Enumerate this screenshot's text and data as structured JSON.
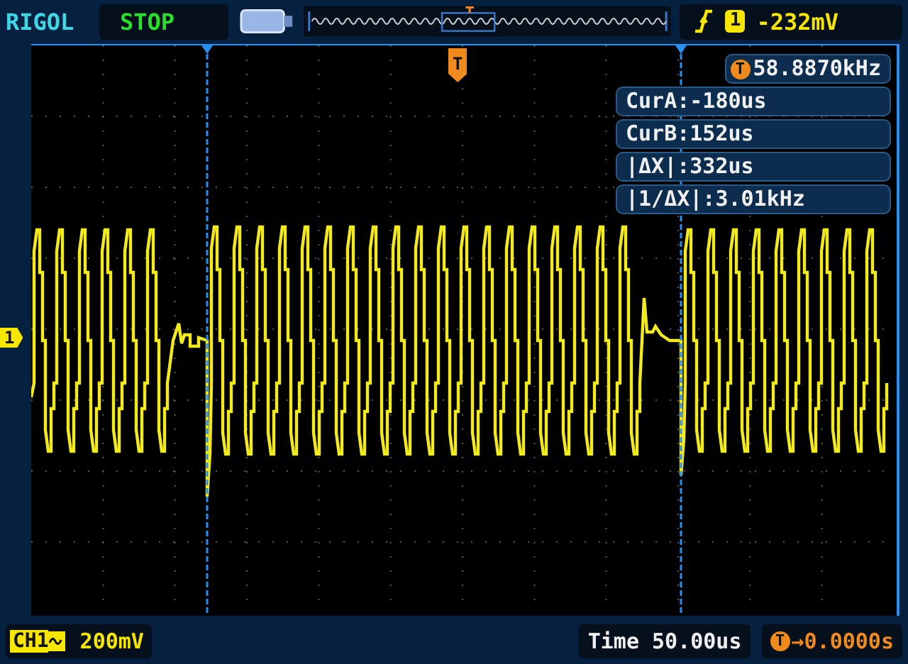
{
  "header": {
    "brand": "RIGOL",
    "run_state": "STOP",
    "trigger": {
      "channel": "1",
      "level": "-232mV"
    }
  },
  "markers": {
    "trigger": "T",
    "channel": "1"
  },
  "readouts": {
    "trigger_badge": "T",
    "frequency": "58.8870kHz",
    "cursor_lines": [
      "CurA:-180us",
      "CurB:152us",
      "|ΔX|:332us",
      "|1/ΔX|:3.01kHz"
    ]
  },
  "footer": {
    "channel": "CH1",
    "scale": "200mV",
    "timebase": "Time 50.00us",
    "trigger_badge": "T",
    "offset": "→0.0000s"
  }
}
